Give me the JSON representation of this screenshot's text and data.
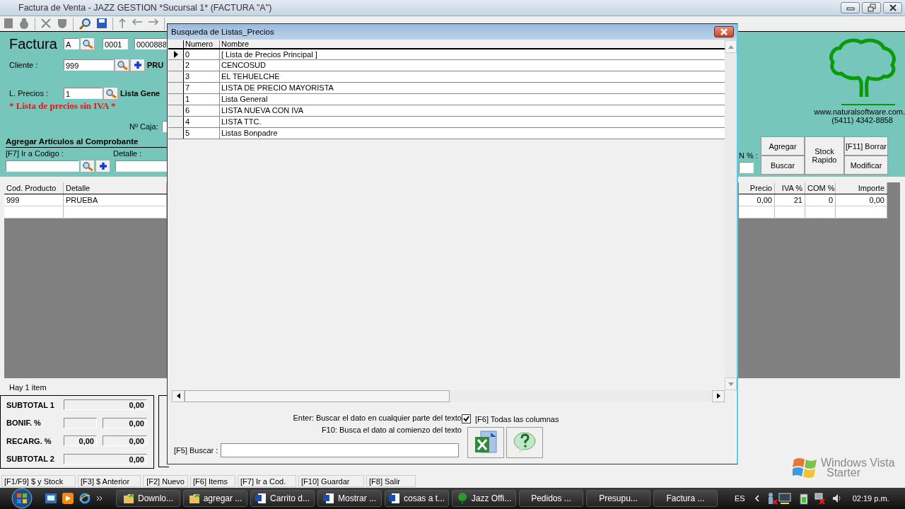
{
  "window": {
    "title": "Factura de Venta - JAZZ GESTION *Sucursal 1* (FACTURA \"A\")"
  },
  "header": {
    "doc_label": "Factura",
    "letter": "A",
    "point": "0001",
    "number": "0000888",
    "client_label": "Cliente :",
    "client_code": "999",
    "client_name": "PRU",
    "price_list_label": "L. Precios :",
    "price_list_code": "1",
    "price_list_name": "Lista Gene",
    "price_list_note": "* Lista de precios sin IVA *",
    "cash_label": "Nº Caja:"
  },
  "add_items": {
    "title": "Agregar Artículos al Comprobante",
    "code_label": "[F7] Ir a Codigo :",
    "detail_label": "Detalle :",
    "percent_label": "N % :",
    "buttons": [
      {
        "label": "Agregar",
        "kind": "top"
      },
      {
        "label": "Buscar",
        "kind": "bottom"
      },
      {
        "label": "Stock Rapido",
        "kind": "tall"
      },
      {
        "label": "[F11] Borrar",
        "kind": "top"
      },
      {
        "label": "Modificar",
        "kind": "bottom"
      }
    ]
  },
  "brand": {
    "url": "www.naturalsoftware.com.",
    "phone": "(5411) 4342-8858"
  },
  "items_table": {
    "columns": [
      "Cod. Producto",
      "Detalle",
      "Precio",
      "IVA %",
      "COM %",
      "Importe"
    ],
    "rows": [
      [
        "999",
        "PRUEBA",
        "0,00",
        "21",
        "0",
        "0,00"
      ]
    ]
  },
  "item_count": "Hay 1 item",
  "totals": [
    {
      "label": "SUBTOTAL 1",
      "kind": "single",
      "value": "0,00"
    },
    {
      "label": "BONIF. %",
      "kind": "pair",
      "value": "0,00"
    },
    {
      "label": "RECARG. %",
      "kind": "pair",
      "percent": "0,00",
      "value": "0,00"
    },
    {
      "label": "SUBTOTAL 2",
      "kind": "single",
      "value": "0,00"
    }
  ],
  "function_keys": [
    "[F1/F9] $ y Stock",
    "[F3] $ Anterior",
    "[F2] Nuevo",
    "[F6] Items",
    "[F7] Ir a Cod.",
    "[F10] Guardar",
    "[F8] Salir"
  ],
  "dialog": {
    "title": "Busqueda de Listas_Precios",
    "columns": [
      "Numero",
      "Nombre"
    ],
    "rows": [
      {
        "number": "0",
        "name": "[ Lista de Precios Principal ]",
        "selected": true
      },
      {
        "number": "2",
        "name": "CENCOSUD",
        "selected": false
      },
      {
        "number": "3",
        "name": "EL TEHUELCHE",
        "selected": false
      },
      {
        "number": "7",
        "name": "LISTA DE PRECIO MAYORISTA",
        "selected": false
      },
      {
        "number": "1",
        "name": "Lista General",
        "selected": false
      },
      {
        "number": "6",
        "name": "LISTA NUEVA CON IVA",
        "selected": false
      },
      {
        "number": "4",
        "name": "LISTA TTC.",
        "selected": false
      },
      {
        "number": "5",
        "name": "Listas Bonpadre",
        "selected": false
      }
    ],
    "hints": [
      "Enter: Buscar el dato en cualquier parte del texto",
      "F10: Busca el dato al comienzo del texto"
    ],
    "all_columns": {
      "label": "[F6]  Todas las columnas",
      "checked": true
    },
    "search_label": "[F5] Buscar :"
  },
  "os_brand": {
    "name": "Windows Vista",
    "edition": "Starter"
  },
  "taskbar": {
    "items": [
      {
        "label": "Downlo...",
        "kind": "folder"
      },
      {
        "label": "agregar ...",
        "kind": "folder"
      },
      {
        "label": "Carrito d...",
        "kind": "word"
      },
      {
        "label": "Mostrar ...",
        "kind": "word"
      },
      {
        "label": "cosas a t...",
        "kind": "word"
      },
      {
        "label": "Jazz Offi...",
        "kind": "tree"
      },
      {
        "label": "Pedidos ...",
        "kind": "none"
      },
      {
        "label": "Presupu...",
        "kind": "none"
      },
      {
        "label": "Factura ...",
        "kind": "none"
      }
    ],
    "language": "ES",
    "clock": "02:19 p.m."
  }
}
